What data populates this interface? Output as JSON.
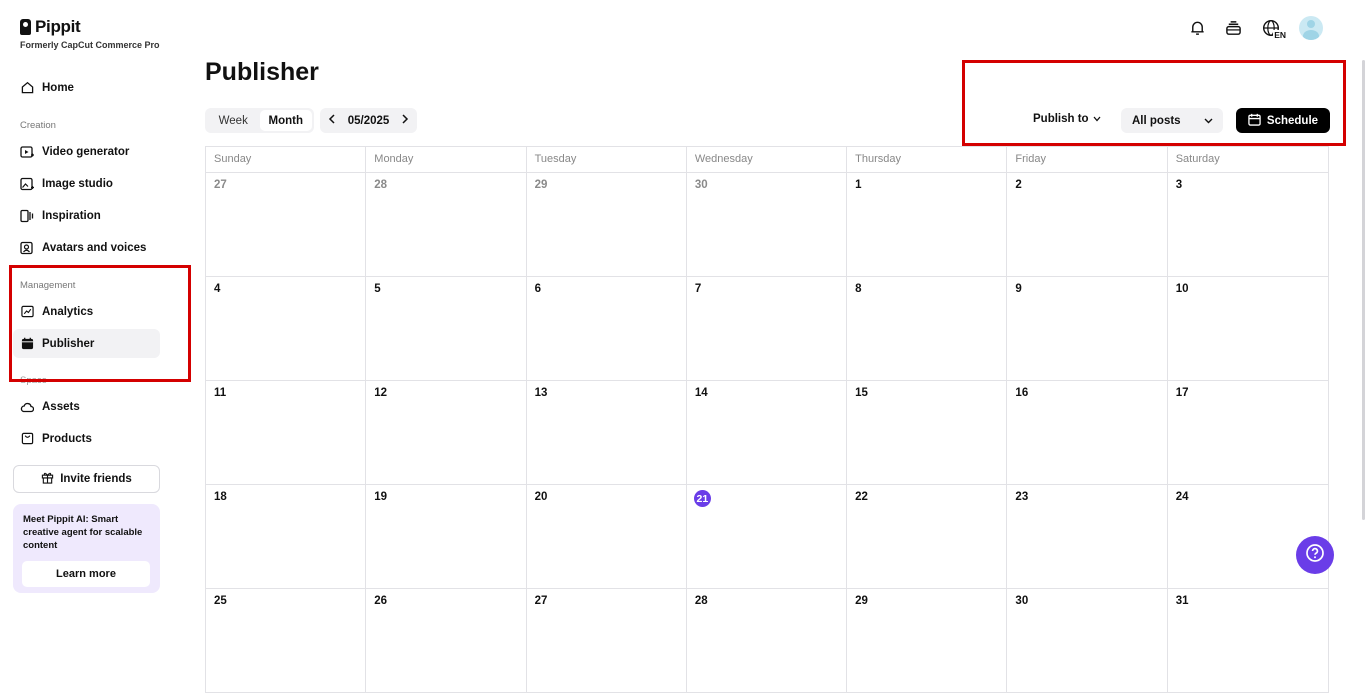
{
  "brand": {
    "name": "Pippit",
    "subtitle": "Formerly CapCut Commerce Pro"
  },
  "sidebar": {
    "home": "Home",
    "creation_label": "Creation",
    "creation_items": [
      "Video generator",
      "Image studio",
      "Inspiration",
      "Avatars and voices"
    ],
    "management_label": "Management",
    "management_items": [
      "Analytics",
      "Publisher"
    ],
    "space_label": "Space",
    "space_items": [
      "Assets",
      "Products"
    ],
    "invite_label": "Invite friends",
    "promo_text": "Meet Pippit AI: Smart creative agent for scalable content",
    "promo_button": "Learn more"
  },
  "header": {
    "title": "Publisher",
    "language_badge": "EN"
  },
  "toolbar": {
    "view_week": "Week",
    "view_month": "Month",
    "current_period": "05/2025",
    "publish_to": "Publish to",
    "filter_selected": "All posts",
    "schedule_label": "Schedule"
  },
  "calendar": {
    "weekdays": [
      "Sunday",
      "Monday",
      "Tuesday",
      "Wednesday",
      "Thursday",
      "Friday",
      "Saturday"
    ],
    "weeks": [
      [
        "27",
        "28",
        "29",
        "30",
        "1",
        "2",
        "3"
      ],
      [
        "4",
        "5",
        "6",
        "7",
        "8",
        "9",
        "10"
      ],
      [
        "11",
        "12",
        "13",
        "14",
        "15",
        "16",
        "17"
      ],
      [
        "18",
        "19",
        "20",
        "21",
        "22",
        "23",
        "24"
      ],
      [
        "25",
        "26",
        "27",
        "28",
        "29",
        "30",
        "31"
      ]
    ],
    "today": "21"
  },
  "colors": {
    "accent": "#6a3de8",
    "highlight_box": "#d40000",
    "primary_button": "#000000"
  }
}
